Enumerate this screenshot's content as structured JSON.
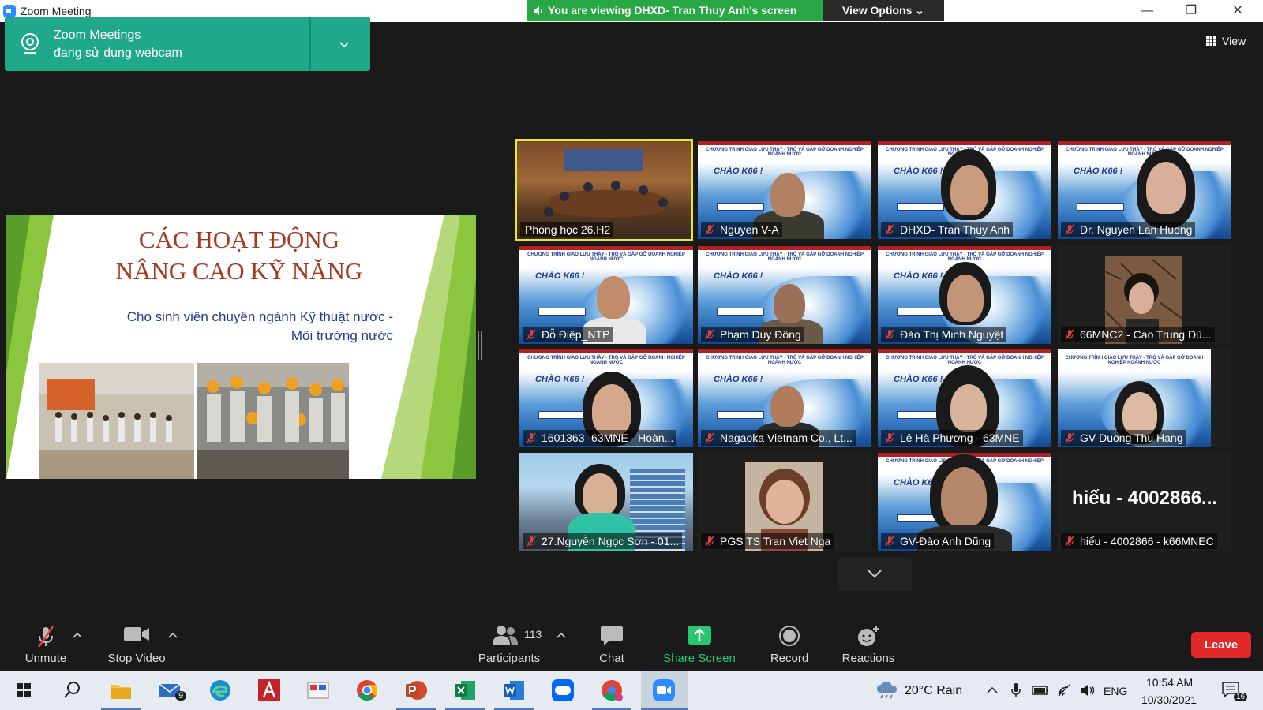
{
  "window": {
    "title": "Zoom Meeting"
  },
  "banner": {
    "viewing": "You are viewing DHXD- Tran Thuy Anh's screen",
    "view_options": "View Options ⌄"
  },
  "toast": {
    "line1": "Zoom Meetings",
    "line2": "đang sử dụng webcam"
  },
  "view_button": "View",
  "slide": {
    "title_line1": "CÁC HOẠT ĐỘNG",
    "title_line2": "NÂNG CAO KỸ NĂNG",
    "subtitle_line1": "Cho sinh viên chuyên ngành Kỹ thuật nước -",
    "subtitle_line2": "Môi trường nước"
  },
  "tile_header": "CHƯƠNG TRÌNH GIAO LƯU THẦY - TRÒ VÀ GẶP GỠ DOANH NGHIỆP NGÀNH NƯỚC",
  "tile_greeting": "CHÀO K66 !",
  "participants": [
    {
      "name": "Phòng học 26.H2",
      "muted": false,
      "active": true
    },
    {
      "name": "Nguyen V-A",
      "muted": true
    },
    {
      "name": "DHXD- Tran Thuy Anh",
      "muted": true
    },
    {
      "name": "Dr. Nguyen Lan Huong",
      "muted": true
    },
    {
      "name": "Đỗ Điệp_NTP",
      "muted": true
    },
    {
      "name": "Phạm Duy Đông",
      "muted": true
    },
    {
      "name": "Đào Thị Minh Nguyệt",
      "muted": true
    },
    {
      "name": "66MNC2 - Cao Trung Dũ...",
      "muted": true
    },
    {
      "name": "1601363 -63MNE - Hoàn...",
      "muted": true
    },
    {
      "name": "Nagaoka Vietnam Co., Lt...",
      "muted": true
    },
    {
      "name": "Lê Hà Phương - 63MNE",
      "muted": true
    },
    {
      "name": "GV-Duong Thu Hang",
      "muted": true
    },
    {
      "name": "27.Nguyễn Ngọc Sơn - 01...",
      "muted": true
    },
    {
      "name": "PGS TS Tran Viet Nga",
      "muted": true
    },
    {
      "name": "GV-Đào Anh Dũng",
      "muted": true
    },
    {
      "name": "hiếu - 4002866 - k66MNEC",
      "muted": true,
      "display_text": "hiếu - 4002866..."
    }
  ],
  "toolbar": {
    "unmute": "Unmute",
    "stop_video": "Stop Video",
    "participants": "Participants",
    "participant_count": "113",
    "chat": "Chat",
    "share_screen": "Share Screen",
    "record": "Record",
    "reactions": "Reactions",
    "leave": "Leave"
  },
  "taskbar": {
    "mail_badge": "9",
    "weather": "20°C  Rain",
    "language": "ENG",
    "time": "10:54 AM",
    "date": "10/30/2021",
    "notifications": "16"
  },
  "colors": {
    "share_screen_green": "#28c76f",
    "leave_red": "#e02828",
    "toast_teal": "#1fa889",
    "active_speaker": "#e6e636"
  }
}
